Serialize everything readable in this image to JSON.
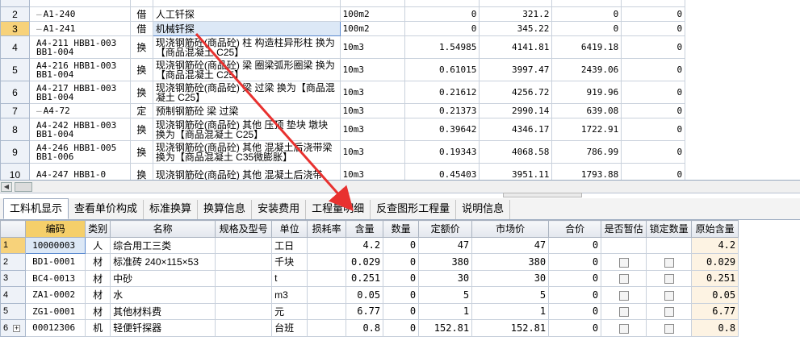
{
  "upper": {
    "rows": [
      {
        "rn": "",
        "code": "",
        "typ": "",
        "name": "",
        "unit": "",
        "qty": "",
        "price": "",
        "total": "",
        "extra": ""
      },
      {
        "rn": "2",
        "code": "A1-240",
        "typ": "借",
        "name": "人工钎探",
        "unit": "100m2",
        "qty": "0",
        "price": "321.2",
        "total": "0",
        "extra": "0"
      },
      {
        "rn": "3",
        "code": "A1-241",
        "typ": "借",
        "name": "机械钎探",
        "unit": "100m2",
        "qty": "0",
        "price": "345.22",
        "total": "0",
        "extra": "0"
      },
      {
        "rn": "4",
        "code": "A4-211 HBB1-003 BB1-004",
        "typ": "换",
        "name": "现浇钢筋砼(商品砼) 柱 构造柱异形柱 换为【商品混凝土 C25】",
        "unit": "10m3",
        "qty": "1.54985",
        "price": "4141.81",
        "total": "6419.18",
        "extra": "0"
      },
      {
        "rn": "5",
        "code": "A4-216 HBB1-003 BB1-004",
        "typ": "换",
        "name": "现浇钢筋砼(商品砼) 梁 圈梁弧形圈梁 换为【商品混凝土 C25】",
        "unit": "10m3",
        "qty": "0.61015",
        "price": "3997.47",
        "total": "2439.06",
        "extra": "0"
      },
      {
        "rn": "6",
        "code": "A4-217 HBB1-003 BB1-004",
        "typ": "换",
        "name": "现浇钢筋砼(商品砼) 梁 过梁 换为【商品混凝土 C25】",
        "unit": "10m3",
        "qty": "0.21612",
        "price": "4256.72",
        "total": "919.96",
        "extra": "0"
      },
      {
        "rn": "7",
        "code": "A4-72",
        "typ": "定",
        "name": "预制钢筋砼 梁 过梁",
        "unit": "10m3",
        "qty": "0.21373",
        "price": "2990.14",
        "total": "639.08",
        "extra": "0"
      },
      {
        "rn": "8",
        "code": "A4-242 HBB1-003 BB1-004",
        "typ": "换",
        "name": "现浇钢筋砼(商品砼) 其他 压顶 垫块 墩块 换为【商品混凝土 C25】",
        "unit": "10m3",
        "qty": "0.39642",
        "price": "4346.17",
        "total": "1722.91",
        "extra": "0"
      },
      {
        "rn": "9",
        "code": "A4-246 HBB1-005 BB1-006",
        "typ": "换",
        "name": "现浇钢筋砼(商品砼) 其他 混凝土后浇带梁 换为【商品混凝土 C35微膨胀】",
        "unit": "10m3",
        "qty": "0.19343",
        "price": "4068.58",
        "total": "786.99",
        "extra": "0"
      },
      {
        "rn": "10",
        "code": "A4-247 HBB1-0",
        "typ": "换",
        "name": "现浇钢筋砼(商品砼) 其他 混凝土后浇带",
        "unit": "10m3",
        "qty": "0.45403",
        "price": "3951.11",
        "total": "1793.88",
        "extra": "0"
      }
    ]
  },
  "tabs": [
    "工料机显示",
    "查看单价构成",
    "标准换算",
    "换算信息",
    "安装费用",
    "工程量明细",
    "反查图形工程量",
    "说明信息"
  ],
  "lower": {
    "headers": [
      "",
      "编码",
      "类别",
      "名称",
      "规格及型号",
      "单位",
      "损耗率",
      "含量",
      "数量",
      "定额价",
      "市场价",
      "合价",
      "是否暂估",
      "锁定数量",
      "原始含量"
    ],
    "rows": [
      {
        "rn": "1",
        "code": "10000003",
        "cat": "人",
        "name": "综合用工三类",
        "spec": "",
        "unit": "工日",
        "loss": "",
        "content": "4.2",
        "qty": "0",
        "quota": "47",
        "market": "47",
        "total": "0",
        "est": "",
        "lock": "",
        "orig": "4.2"
      },
      {
        "rn": "2",
        "code": "BD1-0001",
        "cat": "材",
        "name": "标准砖 240×115×53",
        "spec": "",
        "unit": "千块",
        "loss": "",
        "content": "0.029",
        "qty": "0",
        "quota": "380",
        "market": "380",
        "total": "0",
        "est": "box",
        "lock": "box",
        "orig": "0.029"
      },
      {
        "rn": "3",
        "code": "BC4-0013",
        "cat": "材",
        "name": "中砂",
        "spec": "",
        "unit": "t",
        "loss": "",
        "content": "0.251",
        "qty": "0",
        "quota": "30",
        "market": "30",
        "total": "0",
        "est": "box",
        "lock": "box",
        "orig": "0.251"
      },
      {
        "rn": "4",
        "code": "ZA1-0002",
        "cat": "材",
        "name": "水",
        "spec": "",
        "unit": "m3",
        "loss": "",
        "content": "0.05",
        "qty": "0",
        "quota": "5",
        "market": "5",
        "total": "0",
        "est": "box",
        "lock": "box",
        "orig": "0.05"
      },
      {
        "rn": "5",
        "code": "ZG1-0001",
        "cat": "材",
        "name": "其他材料费",
        "spec": "",
        "unit": "元",
        "loss": "",
        "content": "6.77",
        "qty": "0",
        "quota": "1",
        "market": "1",
        "total": "0",
        "est": "box",
        "lock": "box",
        "orig": "6.77"
      },
      {
        "rn": "6",
        "code": "00012306",
        "cat": "机",
        "name": "轻便钎探器",
        "spec": "",
        "unit": "台班",
        "loss": "",
        "content": "0.8",
        "qty": "0",
        "quota": "152.81",
        "market": "152.81",
        "total": "0",
        "est": "box",
        "lock": "box",
        "orig": "0.8"
      }
    ]
  },
  "colors": {
    "accent_arrow": "#e8312f",
    "selection": "#dce8f6",
    "rownum_selected": "#f7d27a"
  }
}
